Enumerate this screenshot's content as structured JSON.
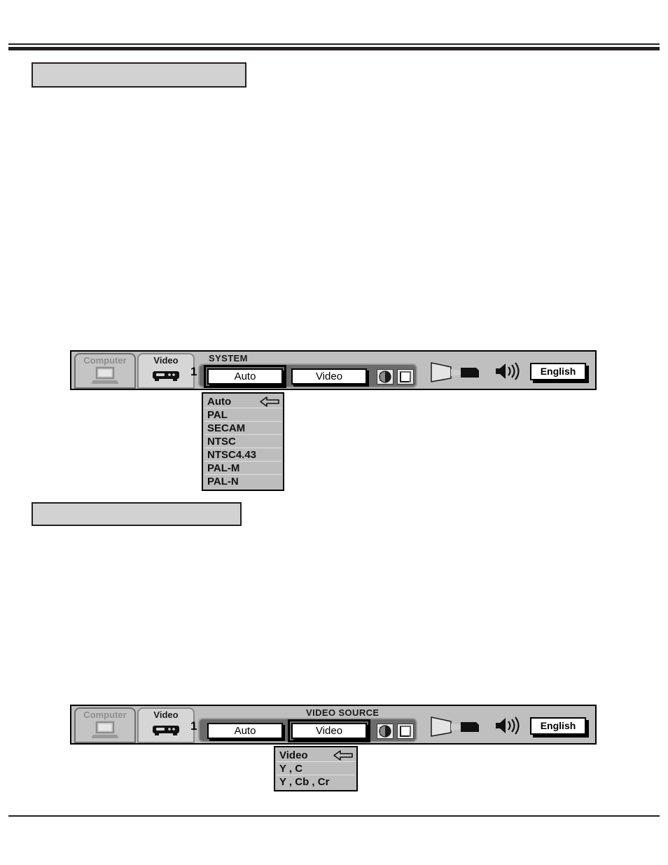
{
  "page": {
    "background_color": "#ffffff",
    "rule_color": "#231f20"
  },
  "captions": [
    {
      "id": "caption-box-1",
      "text": ""
    },
    {
      "id": "caption-box-2",
      "text": ""
    }
  ],
  "osd_menus": [
    {
      "id": "system",
      "title": "SYSTEM",
      "tabs": [
        {
          "label": "Computer",
          "icon": "computer-icon",
          "state": "inactive"
        },
        {
          "label": "Video",
          "icon": "vcr-icon",
          "state": "active",
          "number": "1"
        }
      ],
      "options": [
        {
          "label": "Auto",
          "selected": true
        },
        {
          "label": "Video",
          "selected": false
        }
      ],
      "icon_buttons": [
        {
          "name": "image-adjust-icon"
        },
        {
          "name": "keystone-icon"
        }
      ],
      "right_icons": [
        {
          "name": "projector-screen-icon"
        },
        {
          "name": "sound-icon"
        }
      ],
      "language": "English",
      "dropdown": {
        "items": [
          {
            "label": "Auto",
            "pointer": true
          },
          {
            "label": "PAL",
            "pointer": false
          },
          {
            "label": "SECAM",
            "pointer": false
          },
          {
            "label": "NTSC",
            "pointer": false
          },
          {
            "label": "NTSC4.43",
            "pointer": false
          },
          {
            "label": "PAL-M",
            "pointer": false
          },
          {
            "label": "PAL-N",
            "pointer": false
          }
        ]
      }
    },
    {
      "id": "source",
      "title": "VIDEO SOURCE",
      "tabs": [
        {
          "label": "Computer",
          "icon": "computer-icon",
          "state": "inactive"
        },
        {
          "label": "Video",
          "icon": "vcr-icon",
          "state": "active",
          "number": "1"
        }
      ],
      "options": [
        {
          "label": "Auto",
          "selected": false
        },
        {
          "label": "Video",
          "selected": true
        }
      ],
      "icon_buttons": [
        {
          "name": "image-adjust-icon"
        },
        {
          "name": "keystone-icon"
        }
      ],
      "right_icons": [
        {
          "name": "projector-screen-icon"
        },
        {
          "name": "sound-icon"
        }
      ],
      "language": "English",
      "dropdown": {
        "items": [
          {
            "label": "Video",
            "pointer": true
          },
          {
            "label": "Y , C",
            "pointer": false
          },
          {
            "label": "Y , Cb , Cr",
            "pointer": false
          }
        ]
      }
    }
  ]
}
